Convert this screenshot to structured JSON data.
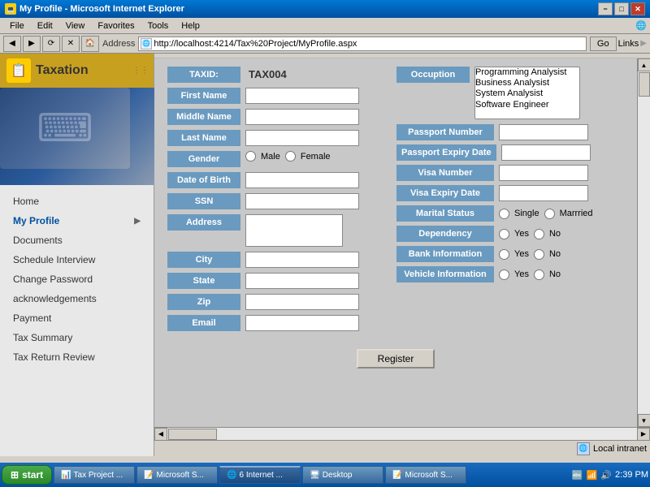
{
  "window": {
    "title": "My Profile - Microsoft Internet Explorer",
    "icon": "💻"
  },
  "titlebar": {
    "title": "My Profile - Microsoft Internet Explorer",
    "buttons": {
      "minimize": "−",
      "restore": "□",
      "close": "✕"
    }
  },
  "menubar": {
    "items": [
      "File",
      "Edit",
      "View",
      "Favorites",
      "Tools",
      "Help"
    ]
  },
  "addressbar": {
    "label": "Address",
    "url": "http://localhost:4214/Tax%20Project/MyProfile.aspx",
    "go_label": "Go",
    "links_label": "Links"
  },
  "sidebar": {
    "logo_text": "Taxation",
    "nav_items": [
      {
        "label": "Home",
        "arrow": false
      },
      {
        "label": "My Profile",
        "arrow": true,
        "active": true
      },
      {
        "label": "Documents",
        "arrow": false
      },
      {
        "label": "Schedule Interview",
        "arrow": false
      },
      {
        "label": "Change Password",
        "arrow": false
      },
      {
        "label": "acknowledgements",
        "arrow": false
      },
      {
        "label": "Payment",
        "arrow": false
      },
      {
        "label": "Tax Summary",
        "arrow": false
      },
      {
        "label": "Tax Return Review",
        "arrow": false
      }
    ]
  },
  "form": {
    "taxid_label": "TAXID:",
    "taxid_value": "TAX004",
    "first_name_label": "First Name",
    "middle_name_label": "Middle Name",
    "last_name_label": "Last Name",
    "gender_label": "Gender",
    "gender_options": [
      "Male",
      "Female"
    ],
    "dob_label": "Date of Birth",
    "ssn_label": "SSN",
    "address_label": "Address",
    "city_label": "City",
    "state_label": "State",
    "zip_label": "Zip",
    "email_label": "Email",
    "first_name_value": "",
    "middle_name_value": "",
    "last_name_value": "",
    "dob_value": "",
    "ssn_value": "",
    "city_value": "",
    "state_value": "",
    "zip_value": "",
    "email_value": ""
  },
  "right_panel": {
    "occupation_label": "Occuption",
    "occupation_options": [
      "Programming Analysist",
      "Business Analysist",
      "System Analysist",
      "Software Engineer"
    ],
    "passport_number_label": "Passport Number",
    "passport_expiry_label": "Passport Expiry Date",
    "visa_number_label": "Visa Number",
    "visa_expiry_label": "Visa Expiry Date",
    "marital_status_label": "Marital Status",
    "marital_options": [
      "Single",
      "Marrried"
    ],
    "dependency_label": "Dependency",
    "dependency_options": [
      "Yes",
      "No"
    ],
    "bank_info_label": "Bank Information",
    "bank_options": [
      "Yes",
      "No"
    ],
    "vehicle_info_label": "Vehicle Information",
    "vehicle_options": [
      "Yes",
      "No"
    ]
  },
  "register_button_label": "Register",
  "status_bar": {
    "left": "",
    "right": "Local intranet"
  },
  "taskbar": {
    "start_label": "start",
    "items": [
      {
        "label": "Tax Project ...",
        "active": false
      },
      {
        "label": "Microsoft S...",
        "active": false
      },
      {
        "label": "6 Internet ...",
        "active": true
      },
      {
        "label": "Desktop",
        "active": false
      },
      {
        "label": "Microsoft S...",
        "active": false
      }
    ],
    "time": "2:39 PM"
  }
}
